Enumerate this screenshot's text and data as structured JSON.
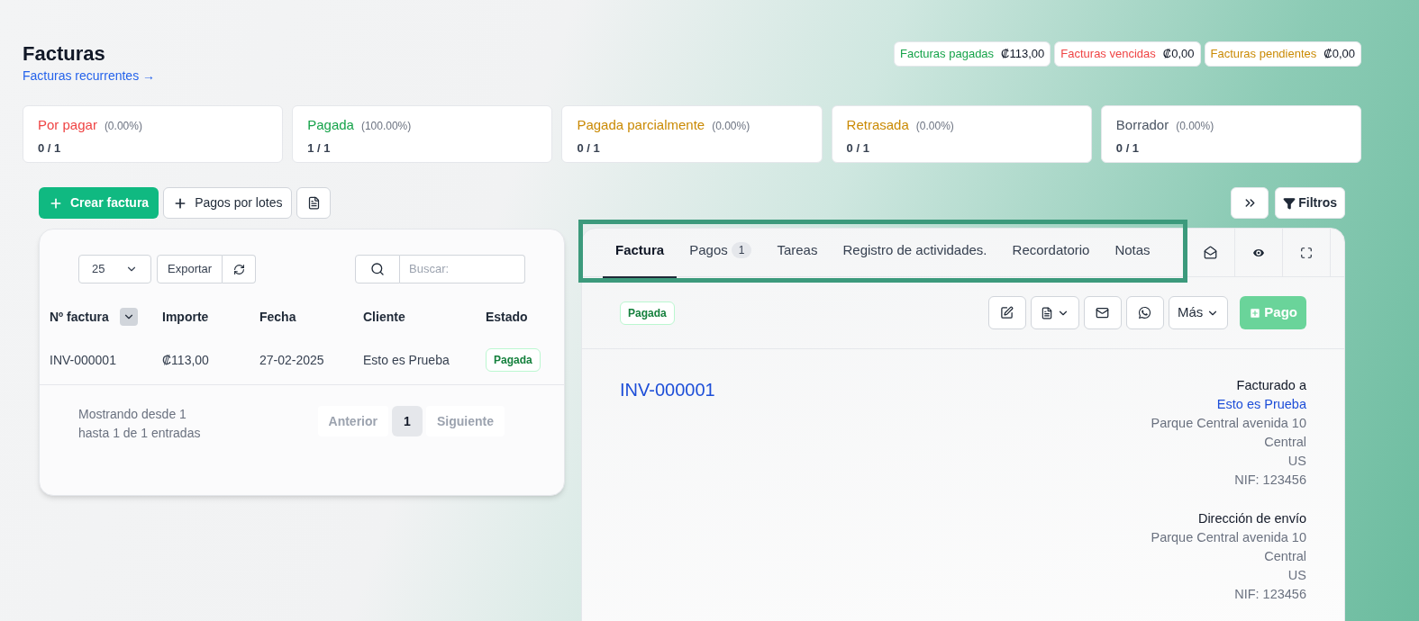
{
  "header": {
    "title": "Facturas",
    "recurring_link": "Facturas recurrentes →"
  },
  "totals": [
    {
      "label": "Facturas pagadas",
      "amount": "₡113,00",
      "color": "#16a34a"
    },
    {
      "label": "Facturas vencidas",
      "amount": "₡0,00",
      "color": "#ef4444"
    },
    {
      "label": "Facturas pendientes",
      "amount": "₡0,00",
      "color": "#ca8a04"
    }
  ],
  "status_cards": [
    {
      "label": "Por pagar",
      "percent": "(0.00%)",
      "count": "0 / 1",
      "color": "#ef4444"
    },
    {
      "label": "Pagada",
      "percent": "(100.00%)",
      "count": "1 / 1",
      "color": "#16a34a"
    },
    {
      "label": "Pagada parcialmente",
      "percent": "(0.00%)",
      "count": "0 / 1",
      "color": "#ca8a04"
    },
    {
      "label": "Retrasada",
      "percent": "(0.00%)",
      "count": "0 / 1",
      "color": "#ca8a04"
    },
    {
      "label": "Borrador",
      "percent": "(0.00%)",
      "count": "0 / 1",
      "color": "#4b5563"
    }
  ],
  "toolbar": {
    "create": "Crear factura",
    "batch": "Pagos por lotes"
  },
  "table": {
    "page_size": "25",
    "export": "Exportar",
    "search_placeholder": "Buscar:",
    "columns": [
      "Nº factura",
      "Importe",
      "Fecha",
      "Cliente",
      "Estado"
    ],
    "rows": [
      {
        "cells": [
          "INV-000001",
          "₡113,00",
          "27-02-2025",
          "Esto es Prueba"
        ],
        "status": "Pagada"
      }
    ],
    "info": "Mostrando desde 1 hasta 1 de 1 entradas",
    "pagination": {
      "previous": "Anterior",
      "pages": [
        {
          "label": "1",
          "selected": true
        }
      ],
      "next": "Siguiente"
    }
  },
  "filters": "Filtros",
  "detail": {
    "tabs": [
      {
        "label": "Factura",
        "selected": true
      },
      {
        "label": "Pagos",
        "badge": "1",
        "selected": false
      },
      {
        "label": "Tareas",
        "selected": false
      },
      {
        "label": "Registro de actividades.",
        "selected": false
      },
      {
        "label": "Recordatorio",
        "selected": false
      },
      {
        "label": "Notas",
        "selected": false
      }
    ],
    "status": "Pagada",
    "more": "Más",
    "payment": "Pago",
    "number": "INV-000001",
    "billed_to": {
      "title": "Facturado a",
      "name": "Esto es Prueba",
      "lines": [
        "Parque Central avenida 10",
        "Central",
        "US",
        "NIF: 123456"
      ]
    },
    "shipping": {
      "title": "Dirección de envío",
      "lines": [
        "Parque Central avenida 10",
        "Central",
        "US",
        "NIF: 123456"
      ]
    }
  }
}
